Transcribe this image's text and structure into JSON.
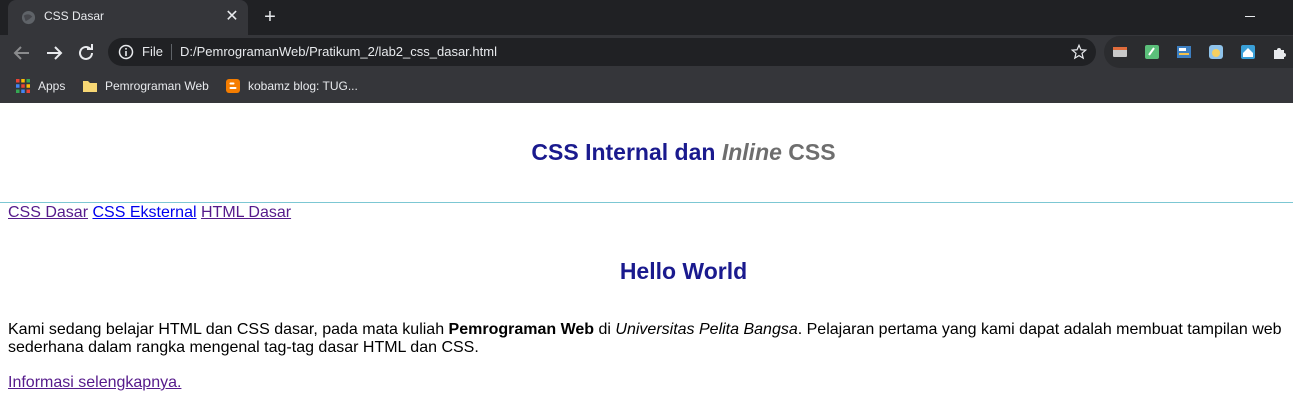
{
  "browser": {
    "tab_title": "CSS Dasar",
    "new_tab_glyph": "+",
    "close_glyph": "✕",
    "omnibox": {
      "scheme_label": "File",
      "url": "D:/PemrogramanWeb/Pratikum_2/lab2_css_dasar.html"
    },
    "bookmarks": [
      {
        "label": "Apps",
        "icon": "apps-grid-icon"
      },
      {
        "label": "Pemrograman Web",
        "icon": "folder-icon"
      },
      {
        "label": "kobamz blog: TUG...",
        "icon": "blogger-icon"
      }
    ],
    "colors": {
      "titlebar": "#202124",
      "toolbar": "#35363a",
      "omnibox": "#202124",
      "text": "#e8eaed"
    }
  },
  "page": {
    "title": {
      "part1": "CSS Internal dan ",
      "part2_italic": "Inline",
      "part3": " CSS"
    },
    "nav_links": [
      "CSS Dasar",
      "CSS Eksternal",
      "HTML Dasar"
    ],
    "heading": "Hello World",
    "paragraph": {
      "t1": "Kami sedang belajar HTML dan CSS dasar, pada mata kuliah ",
      "bold": "Pemrograman Web",
      "t2": " di ",
      "italic": "Universitas Pelita Bangsa",
      "t3": ". Pelajaran pertama yang kami dapat adalah membuat tampilan web sederhana dalam rangka mengenal tag-tag dasar HTML dan CSS."
    },
    "more_link": "Informasi selengkapnya.",
    "colors": {
      "heading": "#1a1a8e",
      "inline_css": "#6e6e6e",
      "rule": "#7cc7d3",
      "visited_link": "#551a8b",
      "link": "#0000ee"
    }
  }
}
